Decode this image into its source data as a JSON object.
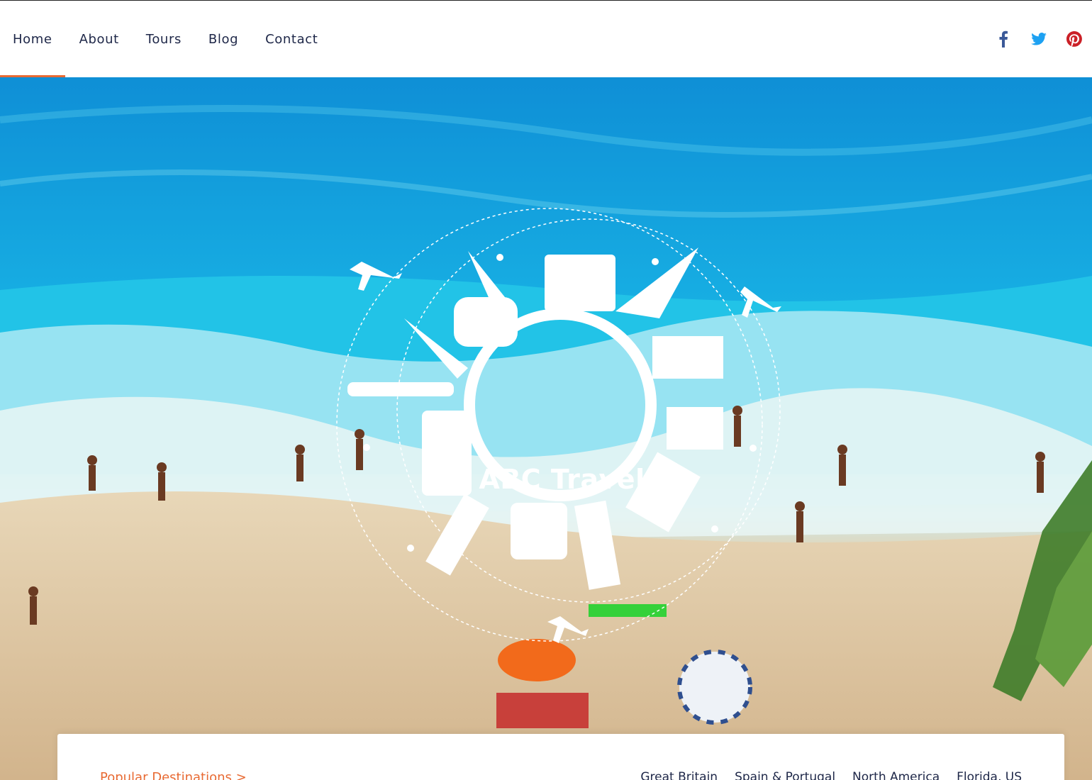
{
  "nav": {
    "items": [
      {
        "label": "Home",
        "active": true
      },
      {
        "label": "About",
        "active": false
      },
      {
        "label": "Tours",
        "active": false
      },
      {
        "label": "Blog",
        "active": false
      },
      {
        "label": "Contact",
        "active": false
      }
    ]
  },
  "social": [
    {
      "icon": "facebook-icon",
      "color": "#3b5998"
    },
    {
      "icon": "twitter-icon",
      "color": "#1da1f2"
    },
    {
      "icon": "pinterest-icon",
      "color": "#cb2027"
    }
  ],
  "hero": {
    "logo_text": "ABC Travel"
  },
  "destinations": {
    "title": "Popular Destinations >",
    "links": [
      "Great Britain",
      "Spain & Portugal",
      "North America",
      "Florida, US"
    ]
  },
  "colors": {
    "accent": "#e86a33",
    "nav_text": "#1e2748",
    "sea": "#14b1e4",
    "sand": "#dcc39d"
  }
}
